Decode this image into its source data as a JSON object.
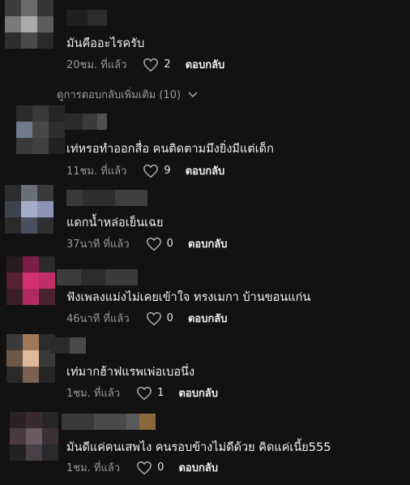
{
  "top_comment": {
    "text": "มันคืออะไรครับ",
    "time": "20ชม. ที่แล้ว",
    "likes": "2",
    "reply_label": "ตอบกลับ"
  },
  "view_more_label": "ดูการตอบกลับเพิ่มเติม (10)",
  "replies": [
    {
      "text": "เท่หรอทำออกสื่อ คนติดตามมึงยิ่งมีแต่เด็ก",
      "time": "11ชม. ที่แล้ว",
      "likes": "9",
      "reply_label": "ตอบกลับ"
    },
    {
      "text": "แดกน้ำหล่อเย็นเฉย",
      "time": "37นาที ที่แล้ว",
      "likes": "0",
      "reply_label": "ตอบกลับ"
    },
    {
      "text": "ฟังเพลงแม่งไม่เคยเข้าใจ ทรงเมกา บ้านขอนแก่น",
      "time": "46นาที ที่แล้ว",
      "likes": "0",
      "reply_label": "ตอบกลับ"
    },
    {
      "text": "เท่มากฮ้าฟแรพเพ่อเบอนึ่ง",
      "time": "1ชม. ที่แล้ว",
      "likes": "1",
      "reply_label": "ตอบกลับ"
    },
    {
      "text": "มันดีแค่คนเสพไง คนรอบข้างไม่ดีด้วย คิดแค่เนี้ย555",
      "time": "1ชม. ที่แล้ว",
      "likes": "0",
      "reply_label": "ตอบกลับ"
    }
  ],
  "colors": {
    "background": "#121212",
    "meta": "#9a9a9a",
    "text": "#f2f2f2",
    "accent_pink": "#d2306f"
  },
  "icons": {
    "like": "heart-outline-icon",
    "expand": "chevron-down-icon"
  }
}
